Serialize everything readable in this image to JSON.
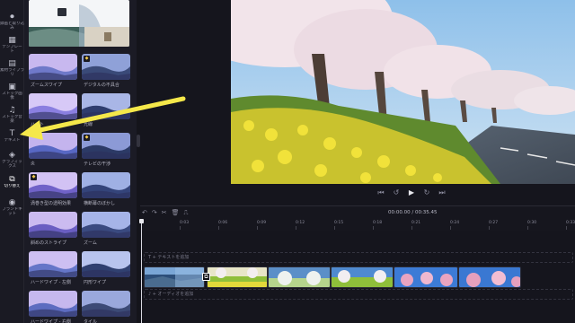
{
  "sidebar": {
    "items": [
      {
        "icon": "record-icon",
        "glyph": "⏺",
        "label": "録画と取り込\nみ"
      },
      {
        "icon": "template-icon",
        "glyph": "▦",
        "label": "テンプレー\nト"
      },
      {
        "icon": "stock-video-icon",
        "glyph": "▤",
        "label": "素材ライブラ\nリ"
      },
      {
        "icon": "stock-image-icon",
        "glyph": "▣",
        "label": "ストック画\n像"
      },
      {
        "icon": "stock-music-icon",
        "glyph": "♫",
        "label": "ストック音\n楽"
      },
      {
        "icon": "text-icon",
        "glyph": "T",
        "label": "テキスト"
      },
      {
        "icon": "graphics-icon",
        "glyph": "◈",
        "label": "グラフィッ\nクス"
      },
      {
        "icon": "transition-icon",
        "glyph": "⧉",
        "label": "切り替え"
      },
      {
        "icon": "brand-kit-icon",
        "glyph": "◉",
        "label": "ブランドキ\nット"
      }
    ],
    "active_index": 7
  },
  "transitions": [
    {
      "label": "ズームスワイプ",
      "premium": false
    },
    {
      "label": "デジタルの不具合",
      "premium": true
    },
    {
      "label": "ハート",
      "premium": false
    },
    {
      "label": "光線",
      "premium": false
    },
    {
      "label": "炎",
      "premium": false
    },
    {
      "label": "テレビの干渉",
      "premium": true
    },
    {
      "label": "渦巻き型の透明効果",
      "premium": true
    },
    {
      "label": "横断幕のぼかし",
      "premium": false
    },
    {
      "label": "斜めのストライプ",
      "premium": false
    },
    {
      "label": "ズーム",
      "premium": false
    },
    {
      "label": "ハードワイプ - 左側",
      "premium": false
    },
    {
      "label": "円形ワイプ",
      "premium": false
    },
    {
      "label": "ハードワイプ - 右側",
      "premium": false
    },
    {
      "label": "タイル",
      "premium": false
    }
  ],
  "timeline": {
    "timecode": "00:00.00 / 00:35.45",
    "ticks": [
      "0:03",
      "0:06",
      "0:09",
      "0:12",
      "0:15",
      "0:18",
      "0:21",
      "0:24",
      "0:27",
      "0:30",
      "0:33"
    ],
    "text_placeholder": "T  + テキストを追加",
    "audio_placeholder": "♪  + オーディオを追加"
  },
  "playback": {
    "prev": "⏮",
    "rewind": "↺",
    "play": "▶",
    "forward": "↻",
    "next": "⏭"
  },
  "colors": {
    "accent": "#f5e84a",
    "background": "#15151d",
    "panel": "#1b1b25"
  }
}
